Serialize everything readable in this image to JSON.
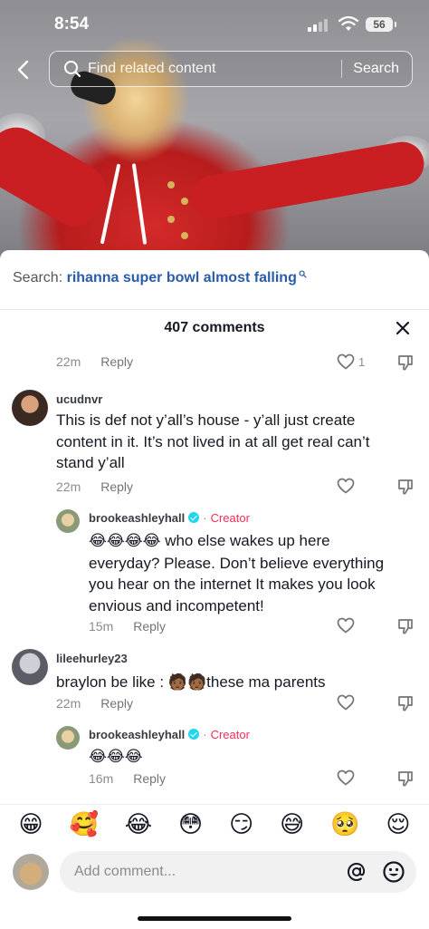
{
  "status": {
    "time": "8:54",
    "battery": "56"
  },
  "search": {
    "placeholder": "Find related content",
    "button": "Search"
  },
  "suggestion": {
    "prefix": "Search:",
    "query": "rihanna super bowl almost falling"
  },
  "comments_header": {
    "count_label": "407 comments"
  },
  "actions": {
    "reply_label": "Reply"
  },
  "thread": {
    "top": {
      "time": "22m",
      "likes": "1"
    },
    "c1": {
      "user": "ucudnvr",
      "text": "This is def not y’all’s house - y’all just create content in it. It’s not lived in at all get real can’t stand y’all",
      "time": "22m",
      "reply": {
        "user": "brookeashleyhall",
        "badge": "Creator",
        "emoji": "😂😂😂😂",
        "text": " who else wakes up here everyday? Please. Don’t believe everything you hear on the internet It makes you look envious and incompetent!",
        "time": "15m"
      }
    },
    "c2": {
      "user": "lileehurley23",
      "text_before": "braylon be like : ",
      "emoji": "🧑🏾🧑🏾",
      "text_after": "these ma parents",
      "time": "22m",
      "reply": {
        "user": "brookeashleyhall",
        "badge": "Creator",
        "emoji": "😂😂😂",
        "time": "16m"
      }
    }
  },
  "emoji_bar": [
    "😁",
    "🥰",
    "😂",
    "😳",
    "😏",
    "😅",
    "🥺",
    "😌"
  ],
  "composer": {
    "placeholder": "Add comment..."
  },
  "colors": {
    "accent_link": "#2b5cab",
    "creator": "#fe2c55",
    "verified": "#20d5ec"
  }
}
